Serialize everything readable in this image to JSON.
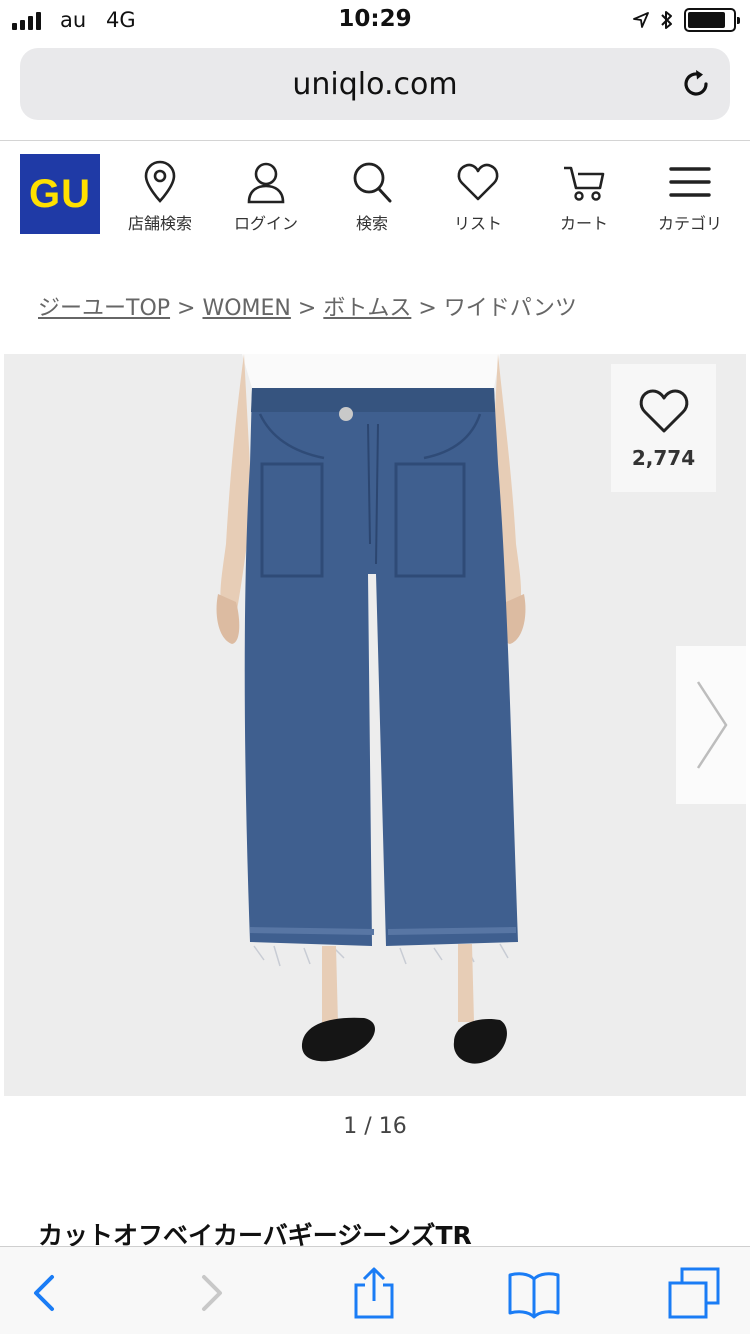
{
  "status_bar": {
    "carrier": "au",
    "network": "4G",
    "time": "10:29",
    "signal_bars": 4,
    "battery_level": 0.85
  },
  "browser": {
    "url": "uniqlo.com",
    "reload_icon": "reload-icon"
  },
  "header": {
    "logo_text": "GU",
    "logo_colors": {
      "background": "#1f3aa6",
      "text": "#ffe100"
    },
    "nav": [
      {
        "label": "店舗検索",
        "icon": "map-pin-icon"
      },
      {
        "label": "ログイン",
        "icon": "user-icon"
      },
      {
        "label": "検索",
        "icon": "search-icon"
      },
      {
        "label": "リスト",
        "icon": "heart-icon"
      },
      {
        "label": "カート",
        "icon": "cart-icon"
      },
      {
        "label": "カテゴリ",
        "icon": "menu-icon"
      }
    ]
  },
  "breadcrumb": {
    "items": [
      "ジーユーTOP",
      "WOMEN",
      "ボトムス"
    ],
    "separator": ">",
    "current": "ワイドパンツ"
  },
  "product": {
    "favorite_count": "2,774",
    "pager": "1 / 16",
    "title": "カットオフベイカーバギージーンズTR",
    "image_colors": {
      "background": "#ededed",
      "denim": "#3f5f8f"
    }
  },
  "toolbar": {
    "icons": [
      "back-icon",
      "forward-icon",
      "share-icon",
      "bookmarks-icon",
      "tabs-icon"
    ],
    "accent": "#1a7cf5"
  }
}
